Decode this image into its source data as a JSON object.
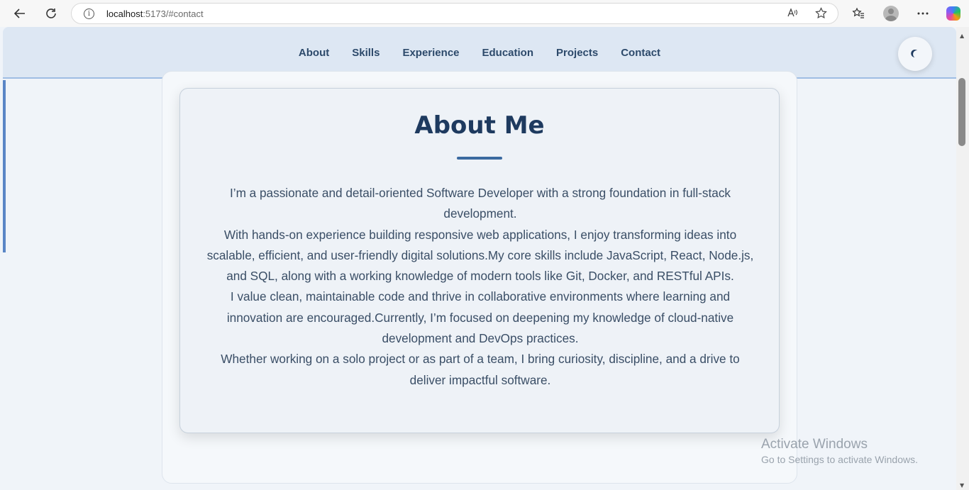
{
  "browser": {
    "url_host": "localhost",
    "url_path": ":5173/#contact",
    "back_icon": "back-arrow-icon",
    "refresh_icon": "refresh-icon",
    "info_glyph": "i"
  },
  "nav": {
    "items": [
      {
        "label": "About"
      },
      {
        "label": "Skills"
      },
      {
        "label": "Experience"
      },
      {
        "label": "Education"
      },
      {
        "label": "Projects"
      },
      {
        "label": "Contact"
      }
    ],
    "theme_toggle_icon": "moon-icon"
  },
  "about": {
    "title": "About Me",
    "paragraphs": [
      "I’m a passionate and detail-oriented Software Developer with a strong foundation in full-stack development.",
      "With hands-on experience building responsive web applications, I enjoy transforming ideas into scalable, efficient, and user-friendly digital solutions.My core skills include JavaScript, React, Node.js, and SQL, along with a working knowledge of modern tools like Git, Docker, and RESTful APIs.",
      "I value clean, maintainable code and thrive in collaborative environments where learning and innovation are encouraged.Currently, I’m focused on deepening my knowledge of cloud-native development and DevOps practices.",
      "Whether working on a solo project or as part of a team, I bring curiosity, discipline, and a drive to deliver impactful software."
    ]
  },
  "watermark": {
    "title": "Activate Windows",
    "subtitle": "Go to Settings to activate Windows."
  },
  "colors": {
    "accent": "#1e3a5f",
    "header_bg": "#dde7f3",
    "underline": "#3b6aa0"
  }
}
